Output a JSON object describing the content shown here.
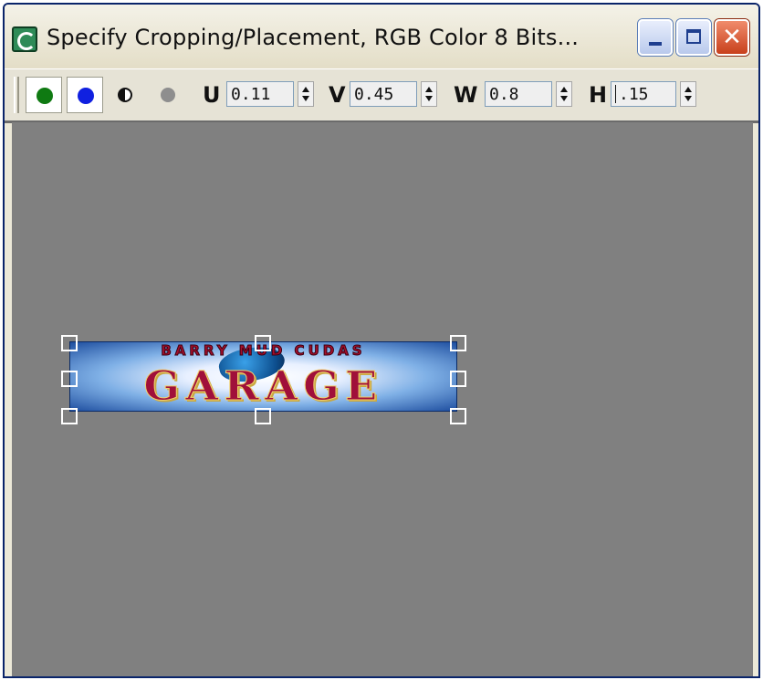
{
  "window": {
    "title": "Specify Cropping/Placement, RGB Color 8 Bits...",
    "close_glyph": "✕"
  },
  "toolbar": {
    "channels": [
      {
        "name": "green-channel",
        "color": "#0f7a12"
      },
      {
        "name": "blue-channel",
        "color": "#1020e0"
      }
    ],
    "u": {
      "label": "U",
      "value": "0.11"
    },
    "v": {
      "label": "V",
      "value": "0.45"
    },
    "w": {
      "label": "W",
      "value": "0.8"
    },
    "h": {
      "label": "H",
      "value": ".15"
    }
  },
  "image": {
    "banner_top": "BARRY MUD CUDAS",
    "banner_main": "GARAGE"
  },
  "colors": {
    "viewport_bg": "#808080",
    "title_bar_bg": "#ece9d8",
    "close_button": "#d9542a",
    "handle": "#ffffff"
  }
}
